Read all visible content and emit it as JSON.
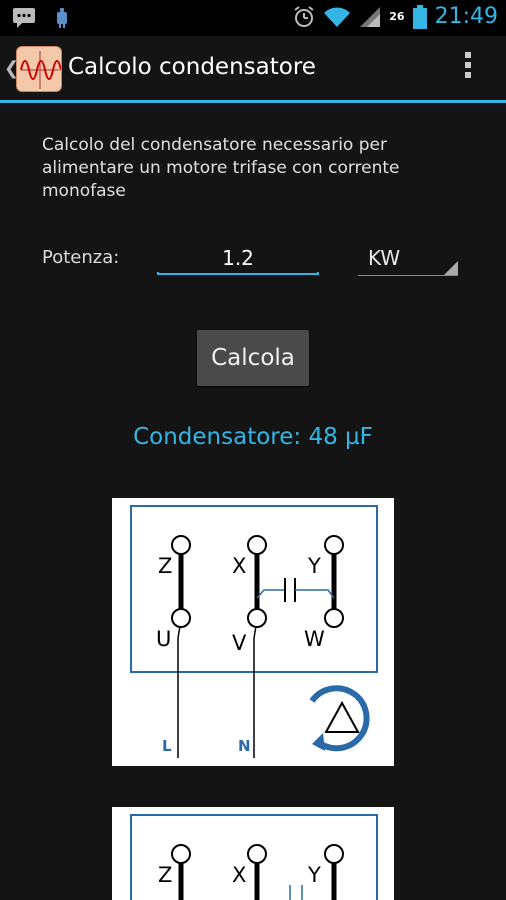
{
  "status_bar": {
    "time": "21:49",
    "badge": "26",
    "icons": [
      "chat-notification-icon",
      "android-notification-icon",
      "alarm-icon",
      "wifi-icon",
      "signal-icon",
      "battery-icon"
    ]
  },
  "action_bar": {
    "title": "Calcolo condensatore",
    "up_glyph": "❮"
  },
  "form": {
    "description": "Calcolo del condensatore necessario per alimentare un motore trifase con corrente monofase",
    "power_label": "Potenza:",
    "power_value": "1.2",
    "unit_selected": "KW",
    "button_label": "Calcola"
  },
  "result": {
    "text": "Condensatore: 48 µF"
  },
  "diagram": {
    "terminals_top": [
      "Z",
      "X",
      "Y"
    ],
    "terminals_bottom": [
      "U",
      "V",
      "W"
    ],
    "supply": [
      "L",
      "N"
    ]
  },
  "colors": {
    "accent": "#33b5e5",
    "diagram_frame": "#2a6aa8",
    "background": "#141414"
  }
}
